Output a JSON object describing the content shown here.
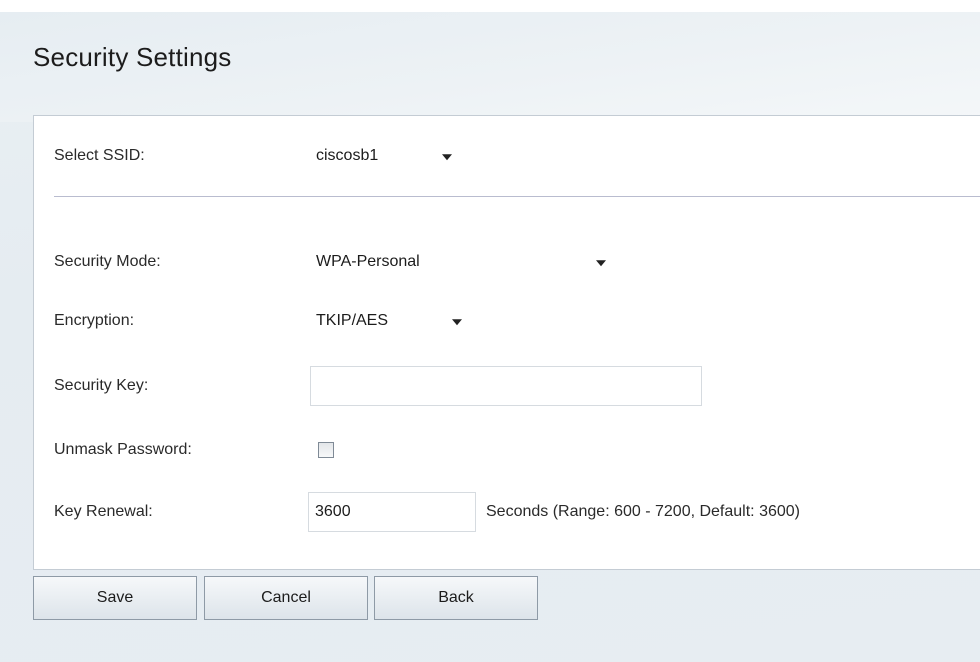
{
  "page": {
    "title": "Security Settings"
  },
  "form": {
    "select_ssid": {
      "label": "Select SSID:",
      "value": "ciscosb1"
    },
    "security_mode": {
      "label": "Security Mode:",
      "value": "WPA-Personal"
    },
    "encryption": {
      "label": "Encryption:",
      "value": "TKIP/AES"
    },
    "security_key": {
      "label": "Security Key:",
      "value": ""
    },
    "unmask_password": {
      "label": "Unmask Password:",
      "checked": false
    },
    "key_renewal": {
      "label": "Key Renewal:",
      "value": "3600",
      "hint": "Seconds  (Range: 600 - 7200, Default: 3600)"
    }
  },
  "buttons": {
    "save": "Save",
    "cancel": "Cancel",
    "back": "Back"
  },
  "icons": {
    "dropdown": "chevron-down-icon",
    "checkbox": "checkbox-icon"
  },
  "colors": {
    "page_background": "#e7edf2",
    "panel_background": "#ffffff",
    "panel_border": "#c4ccd4",
    "divider": "#b9bccf",
    "button_border": "#8e9aa6"
  }
}
